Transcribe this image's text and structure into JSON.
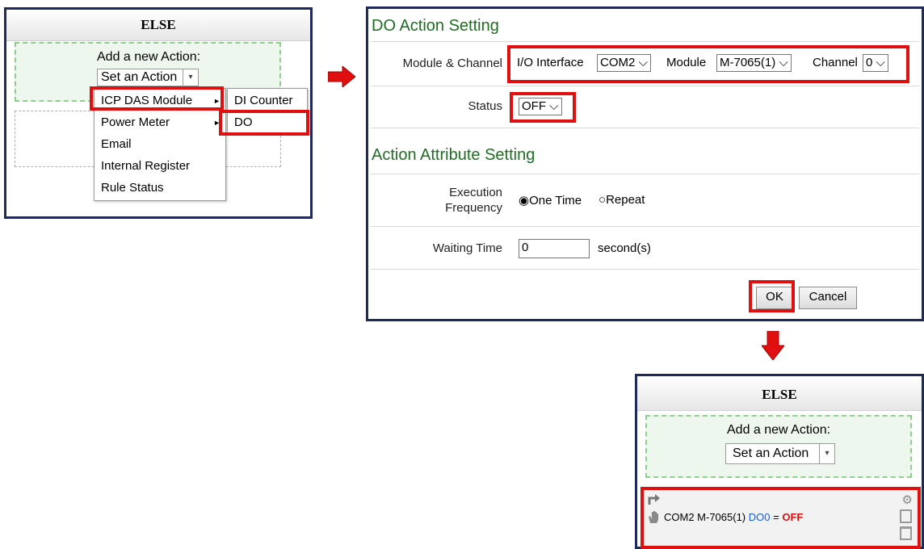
{
  "left_panel": {
    "title": "ELSE",
    "add_action_label": "Add a new Action:",
    "set_action_button": "Set an Action",
    "menu_items": [
      "ICP DAS Module",
      "Power Meter",
      "Email",
      "Internal Register",
      "Rule Status"
    ],
    "submenu_items": [
      "DI Counter",
      "DO"
    ]
  },
  "settings": {
    "do_title": "DO Action Setting",
    "module_channel_label": "Module & Channel",
    "io_interface_label": "I/O Interface",
    "io_interface_value": "COM2",
    "module_label": "Module",
    "module_value": "M-7065(1)",
    "channel_label": "Channel",
    "channel_value": "0",
    "status_label": "Status",
    "status_value": "OFF",
    "attr_title": "Action Attribute Setting",
    "exec_freq_label": "Execution Frequency",
    "exec_freq_line1": "Execution",
    "exec_freq_line2": "Frequency",
    "freq_one_time": "One Time",
    "freq_repeat": "Repeat",
    "waiting_time_label": "Waiting Time",
    "waiting_time_value": "0",
    "waiting_time_unit": "second(s)",
    "ok_button": "OK",
    "cancel_button": "Cancel"
  },
  "result_panel": {
    "title": "ELSE",
    "add_action_label": "Add a new Action:",
    "set_action_button": "Set an Action",
    "action_prefix": "COM2 M-7065(1)",
    "action_channel": "DO0",
    "action_equals": "=",
    "action_value": "OFF"
  },
  "colors": {
    "highlight": "#e01010",
    "section_title": "#1f6e22",
    "channel_blue": "#1a5fd6",
    "value_red": "#e01010"
  }
}
